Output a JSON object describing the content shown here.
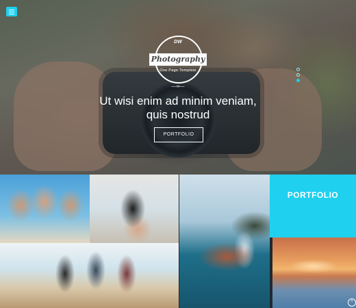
{
  "hero": {
    "logo": {
      "monogram": "DW",
      "title": "Photography",
      "subtitle": "One Page Template"
    },
    "headline_line1": "Ut wisi enim ad minim veniam,",
    "headline_line2": "quis nostrud",
    "button_label": "PORTFOLIO",
    "slider_dots": 3,
    "active_dot": 2
  },
  "gallery": {
    "tiles": [
      "beach-friends-photo",
      "girl-cap-photo",
      "boat-couple-photo",
      "beach-group-photo",
      "sunset-photo"
    ],
    "section_label": "PORTFOLIO"
  },
  "colors": {
    "accent": "#1fd0ef"
  }
}
